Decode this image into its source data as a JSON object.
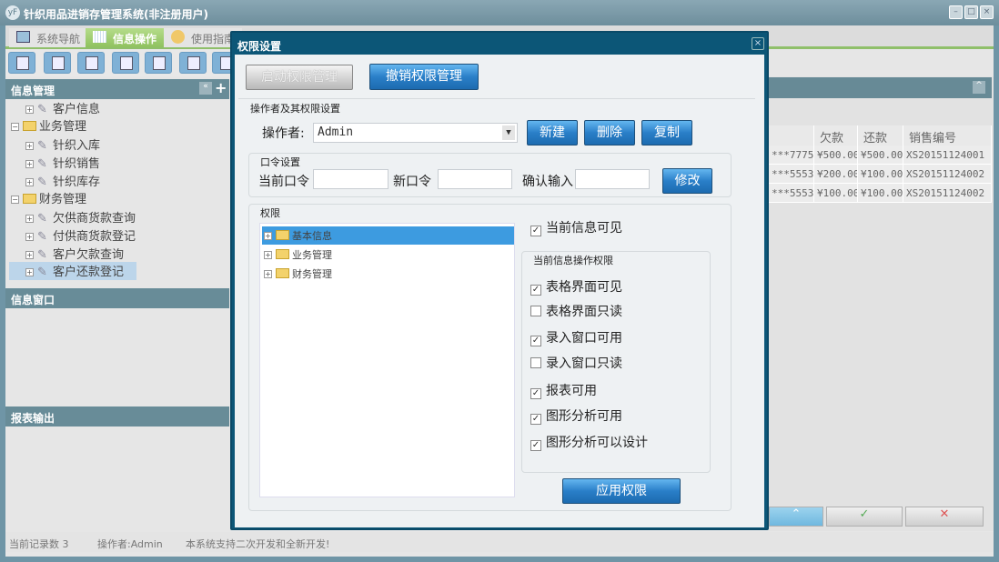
{
  "window": {
    "title": "针织用品进销存管理系统(非注册用户)",
    "logo": "yF"
  },
  "tabs": [
    {
      "label": "系统导航"
    },
    {
      "label": "信息操作"
    },
    {
      "label": "使用指南"
    }
  ],
  "left": {
    "info_header": "信息管理",
    "tree": [
      {
        "label": "客户信息",
        "type": "leaf"
      },
      {
        "label": "业务管理",
        "type": "folder"
      },
      {
        "label": "针织入库",
        "type": "leaf"
      },
      {
        "label": "针织销售",
        "type": "leaf"
      },
      {
        "label": "针织库存",
        "type": "leaf"
      },
      {
        "label": "财务管理",
        "type": "folder"
      },
      {
        "label": "欠供商货款查询",
        "type": "leaf"
      },
      {
        "label": "付供商货款登记",
        "type": "leaf"
      },
      {
        "label": "客户欠款查询",
        "type": "leaf"
      },
      {
        "label": "客户还款登记",
        "type": "leaf",
        "selected": true
      }
    ],
    "window_header": "信息窗口",
    "report_header": "报表输出"
  },
  "table": {
    "columns": [
      "",
      "欠款金",
      "还款金",
      "销售编号"
    ],
    "rows": [
      [
        "***7775",
        "¥500.00",
        "¥500.00",
        "XS20151124001"
      ],
      [
        "***5553",
        "¥200.00",
        "¥100.00",
        "XS20151124002"
      ],
      [
        "***5553",
        "¥100.00",
        "¥100.00",
        "XS20151124002"
      ]
    ]
  },
  "status": {
    "records": "当前记录数 3",
    "operator": "操作者:Admin",
    "message": "本系统支持二次开发和全新开发!"
  },
  "dialog": {
    "title": "权限设置",
    "start_btn": "启动权限管理",
    "revoke_btn": "撤销权限管理",
    "operator_section": "操作者及其权限设置",
    "operator_label": "操作者:",
    "operator_value": "Admin",
    "new_btn": "新建",
    "delete_btn": "删除",
    "copy_btn": "复制",
    "password_section": "口令设置",
    "current_pw_label": "当前口令",
    "new_pw_label": "新口令",
    "confirm_label": "确认输入",
    "modify_btn": "修改",
    "perm_section": "权限",
    "perm_tree": [
      "基本信息",
      "业务管理",
      "财务管理"
    ],
    "visible_label": "当前信息可见",
    "visible_checked": true,
    "ops_section": "当前信息操作权限",
    "ops": [
      {
        "label": "表格界面可见",
        "checked": true
      },
      {
        "label": "表格界面只读",
        "checked": false
      },
      {
        "label": "录入窗口可用",
        "checked": true
      },
      {
        "label": "录入窗口只读",
        "checked": false
      },
      {
        "label": "报表可用",
        "checked": true
      },
      {
        "label": "图形分析可用",
        "checked": true
      },
      {
        "label": "图形分析可以设计",
        "checked": true
      }
    ],
    "apply_btn": "应用权限"
  },
  "colors": {
    "accent": "#2a7fc8",
    "header": "#688c98",
    "dialog_frame": "#0c5677",
    "selection": "#3d9be0"
  }
}
